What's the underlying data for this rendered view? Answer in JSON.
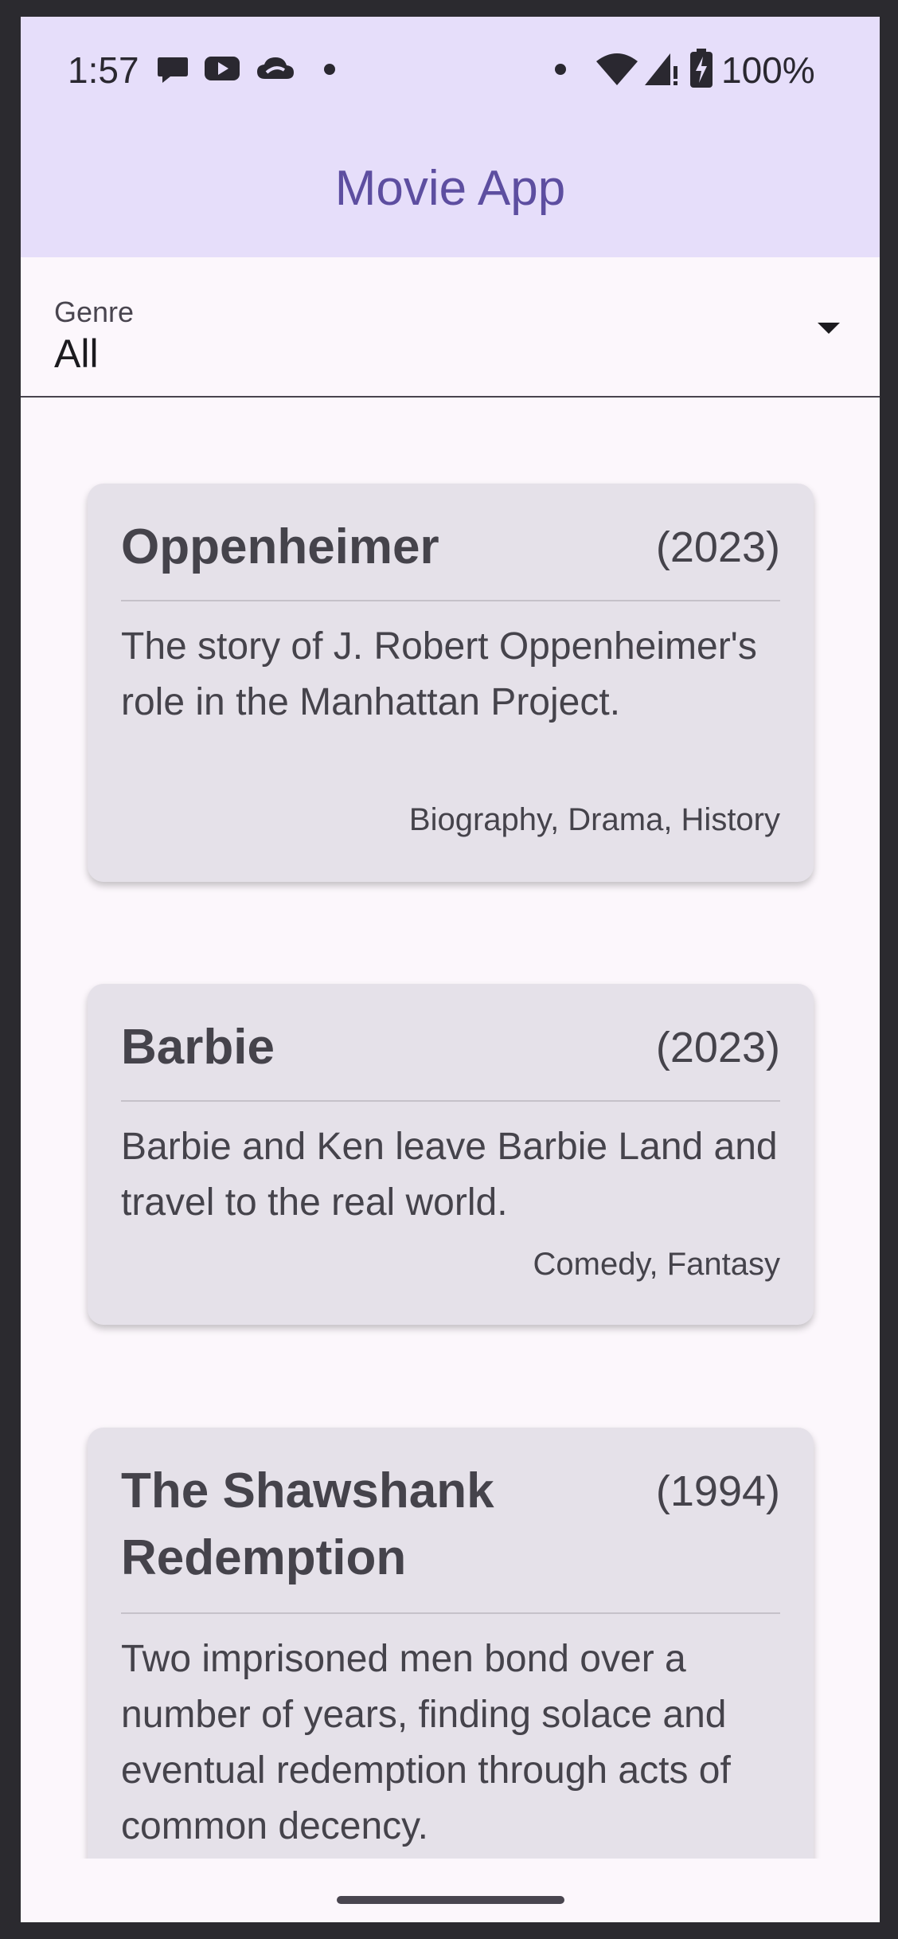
{
  "status_bar": {
    "time": "1:57",
    "battery": "100%",
    "icons": [
      "chat-bubble-icon",
      "youtube-icon",
      "cloud-icon",
      "dot-icon",
      "dot-icon",
      "wifi-icon",
      "signal-icon",
      "battery-charging-icon"
    ]
  },
  "app_bar": {
    "title": "Movie App"
  },
  "genre_filter": {
    "label": "Genre",
    "value": "All"
  },
  "movies": [
    {
      "title": "Oppenheimer",
      "year": "(2023)",
      "description": "The story of J. Robert Oppenheimer's role in the Manhattan Project.",
      "genres": "Biography, Drama, History"
    },
    {
      "title": "Barbie",
      "year": "(2023)",
      "description": "Barbie and Ken leave Barbie Land and travel to the real world.",
      "genres": "Comedy, Fantasy"
    },
    {
      "title": "The Shawshank Redemption",
      "year": "(1994)",
      "description": "Two imprisoned men bond over a number of years, finding solace and eventual redemption through acts of common decency.",
      "genres": ""
    }
  ],
  "colors": {
    "app_bar": "#e6defa",
    "title": "#5d4ea0",
    "card": "#e5e1e9",
    "background": "#fcf7fc"
  }
}
